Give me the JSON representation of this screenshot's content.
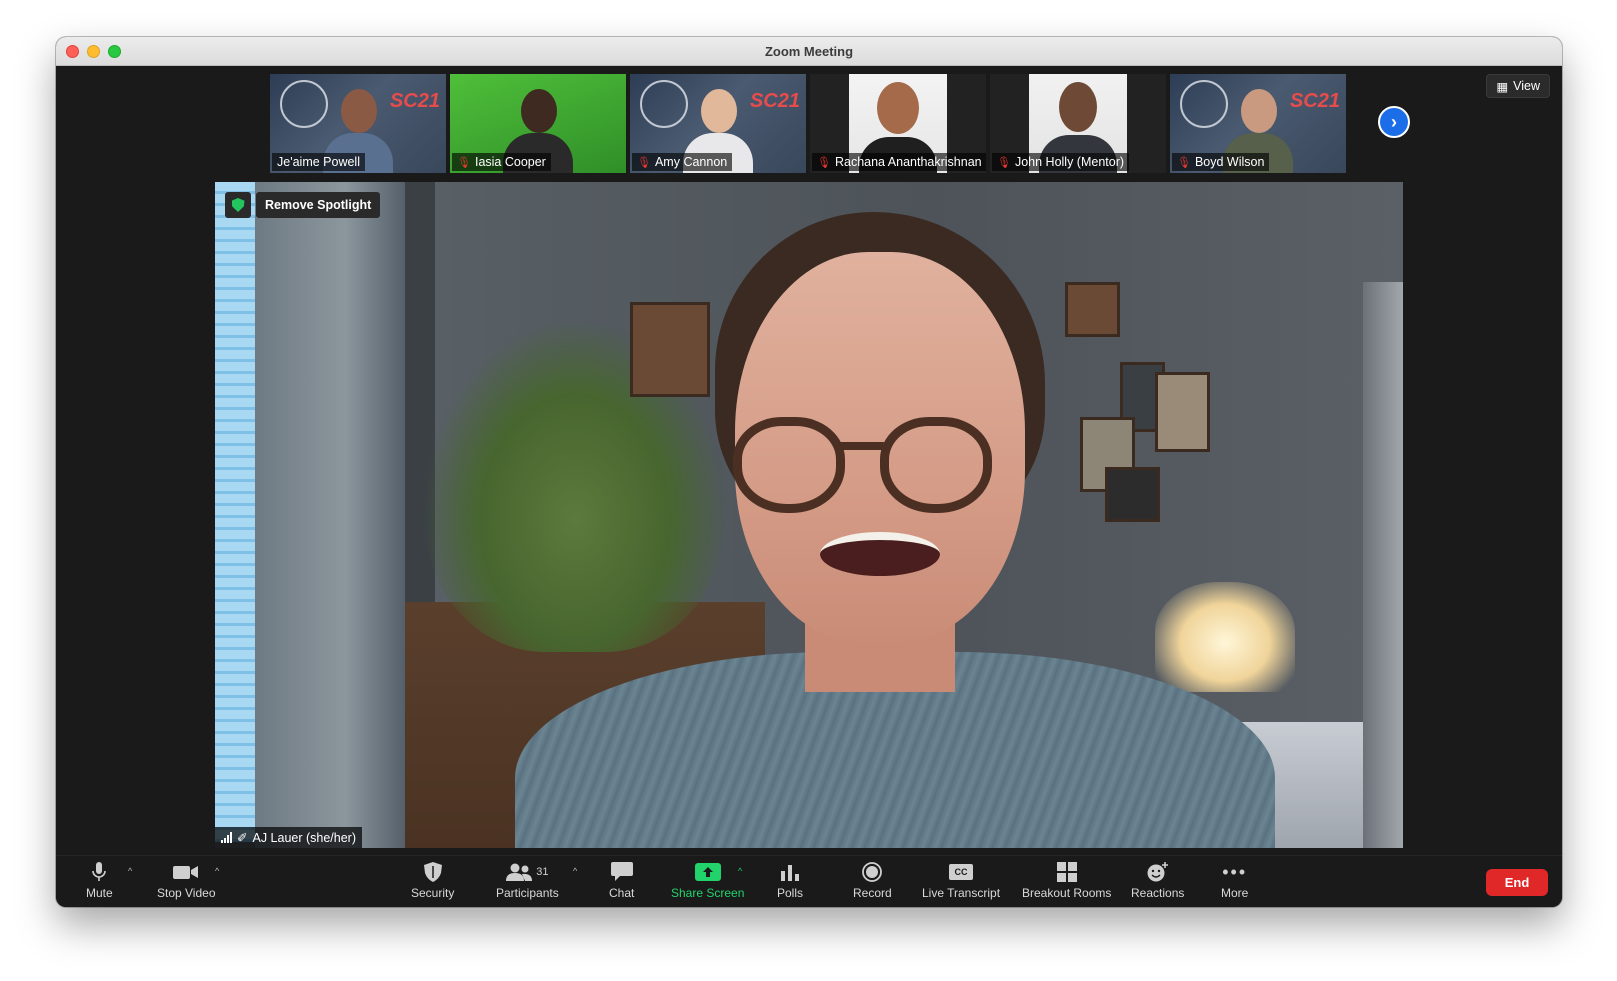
{
  "window": {
    "title": "Zoom Meeting"
  },
  "view_button": {
    "label": "View"
  },
  "gallery": [
    {
      "name": "Je'aime Powell",
      "muted": false,
      "background": "sc21"
    },
    {
      "name": "Iasia Cooper",
      "muted": true,
      "background": "green"
    },
    {
      "name": "Amy Cannon",
      "muted": true,
      "background": "sc21"
    },
    {
      "name": "Rachana Ananthakrishnan",
      "muted": true,
      "background": "photo"
    },
    {
      "name": "John Holly (Mentor)",
      "muted": true,
      "background": "photo"
    },
    {
      "name": "Boyd Wilson",
      "muted": true,
      "background": "sc21"
    }
  ],
  "tile_logo_text": "SC21",
  "spotlight": {
    "button_label": "Remove Spotlight",
    "speaker_name": "AJ Lauer (she/her)"
  },
  "toolbar": {
    "mute": "Mute",
    "stop_video": "Stop Video",
    "security": "Security",
    "participants": "Participants",
    "participants_count": "31",
    "chat": "Chat",
    "share_screen": "Share Screen",
    "polls": "Polls",
    "record": "Record",
    "live_transcript": "Live Transcript",
    "live_transcript_icon_text": "CC",
    "breakout_rooms": "Breakout Rooms",
    "reactions": "Reactions",
    "more": "More",
    "end": "End"
  },
  "colors": {
    "share_green": "#22d36b",
    "end_red": "#e02828",
    "accent_blue": "#1b6ee8",
    "muted_red": "#e5382f"
  }
}
